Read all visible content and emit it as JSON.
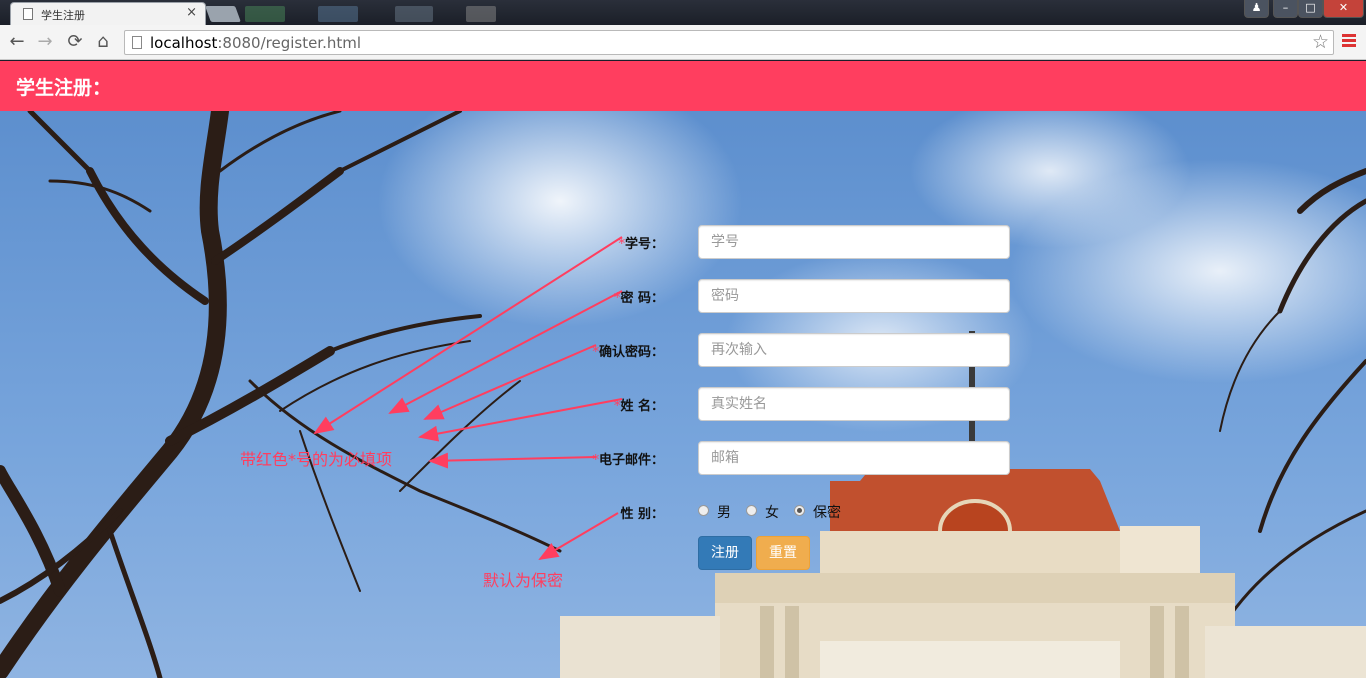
{
  "browser": {
    "tab_title": "学生注册",
    "tab_close": "×",
    "url_host": "localhost",
    "url_rest": ":8080/register.html",
    "back": "←",
    "forward": "→",
    "reload": "⟳",
    "home": "⌂",
    "star": "☆",
    "win_min": "–",
    "win_max": "□",
    "win_close": "✕",
    "user": "♟"
  },
  "header": {
    "title": "学生注册："
  },
  "form": {
    "required_mark": "*",
    "fields": [
      {
        "label": "学号：",
        "placeholder": "学号",
        "required": true
      },
      {
        "label": "密 码：",
        "placeholder": "密码",
        "required": true
      },
      {
        "label": "确认密码：",
        "placeholder": "再次输入",
        "required": true
      },
      {
        "label": "姓 名：",
        "placeholder": "真实姓名",
        "required": true
      },
      {
        "label": "电子邮件：",
        "placeholder": "邮箱",
        "required": true
      }
    ],
    "gender_label": "性 别：",
    "gender_options": [
      {
        "label": "男",
        "selected": false
      },
      {
        "label": "女",
        "selected": false
      },
      {
        "label": "保密",
        "selected": true
      }
    ],
    "submit_label": "注册",
    "reset_label": "重置"
  },
  "annotations": {
    "required_note": "带红色*号的为必填项",
    "default_note": "默认为保密"
  },
  "colors": {
    "header_bg": "#ff3e5f",
    "annotation": "#ff3e5f",
    "primary_button": "#337ab7",
    "warning_button": "#f0ad4e"
  }
}
